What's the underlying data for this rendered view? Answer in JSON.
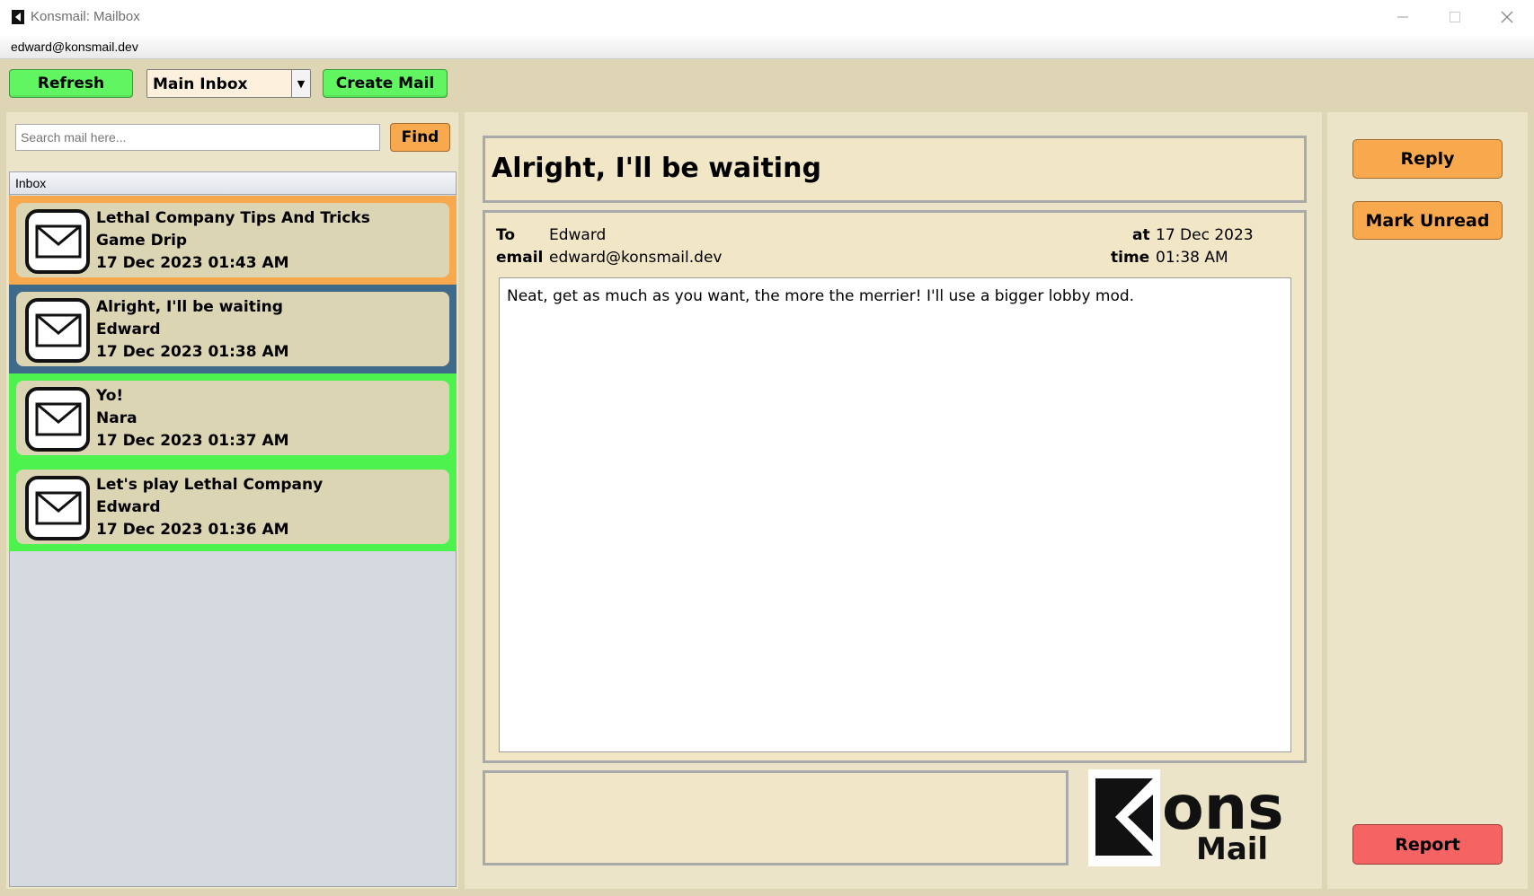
{
  "window": {
    "title": "Konsmail: Mailbox"
  },
  "account": {
    "email": "edward@konsmail.dev"
  },
  "toolbar": {
    "refresh_label": "Refresh",
    "mailbox_selected": "Main Inbox",
    "create_label": "Create Mail"
  },
  "search": {
    "placeholder": "Search mail here...",
    "find_label": "Find"
  },
  "list": {
    "header": "Inbox",
    "items": [
      {
        "subject": "Lethal Company Tips And Tricks",
        "sender": "Game Drip",
        "date": "17 Dec 2023 01:43 AM",
        "color": "#f8a84d"
      },
      {
        "subject": "Alright, I'll be waiting",
        "sender": "Edward",
        "date": "17 Dec 2023 01:38 AM",
        "color": "#3f6a8a"
      },
      {
        "subject": "Yo!",
        "sender": "Nara",
        "date": "17 Dec 2023 01:37 AM",
        "color": "#4ef24e"
      },
      {
        "subject": "Let's play Lethal Company",
        "sender": "Edward",
        "date": "17 Dec 2023 01:36 AM",
        "color": "#4ef24e"
      }
    ]
  },
  "message": {
    "subject": "Alright, I'll be waiting",
    "to_label": "To",
    "to": "Edward",
    "email_label": "email",
    "email": "edward@konsmail.dev",
    "at_label": "at",
    "date": "17 Dec 2023",
    "time_label": "time",
    "time": "01:38 AM",
    "body": "Neat, get as much as you want, the more the merrier! I'll use a bigger lobby mod."
  },
  "logo": {
    "top": "ons",
    "bottom": "Mail"
  },
  "actions": {
    "reply": "Reply",
    "mark_unread": "Mark Unread",
    "report": "Report"
  }
}
